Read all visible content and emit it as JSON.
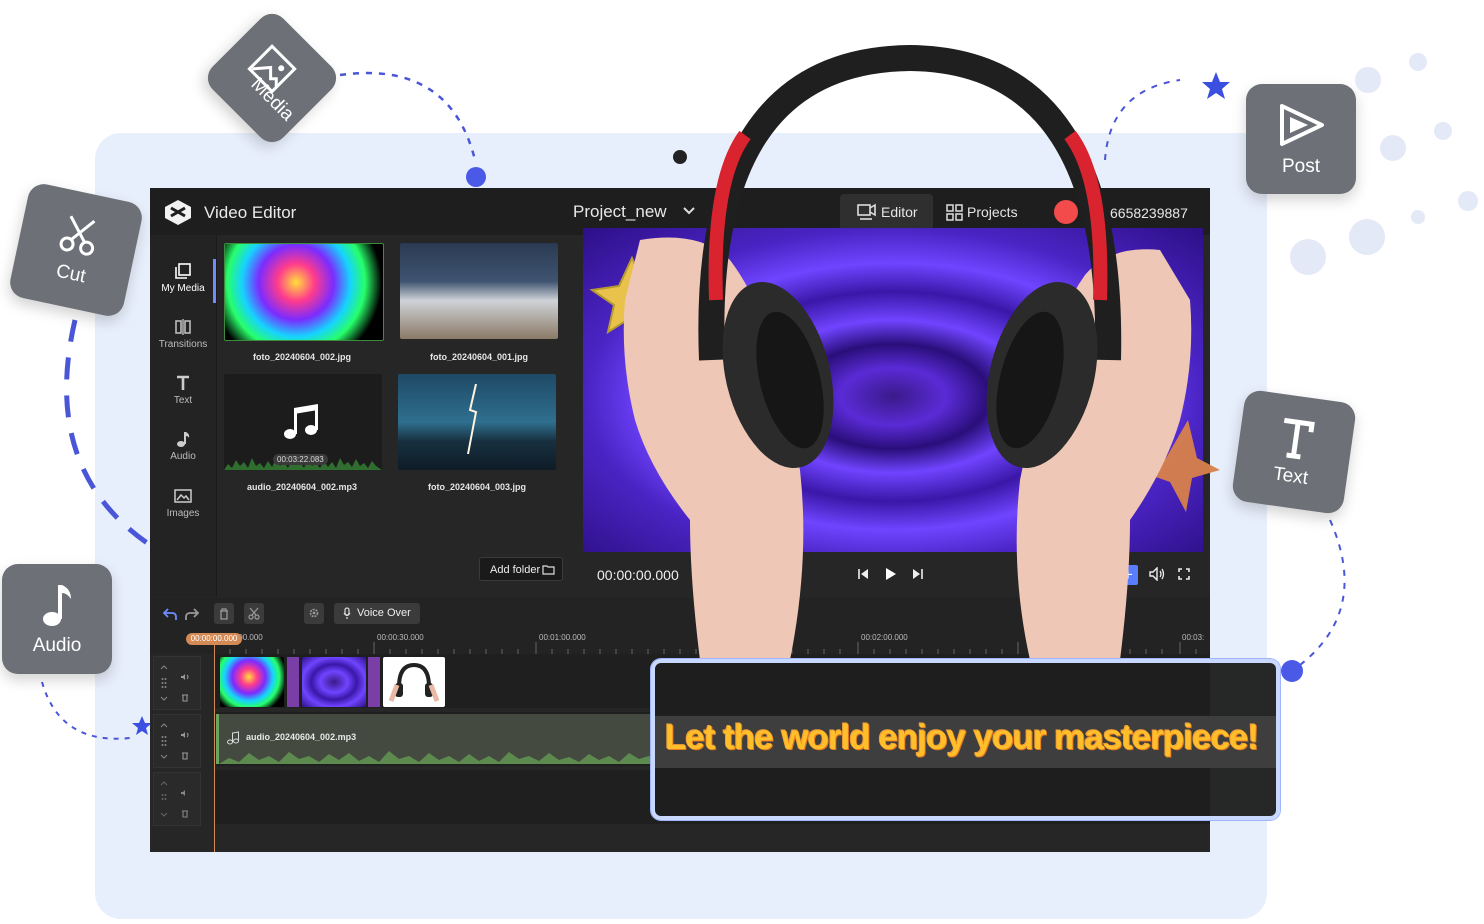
{
  "app": {
    "title": "Video Editor",
    "project_name": "Project_new",
    "tabs": {
      "editor": "Editor",
      "projects": "Projects"
    },
    "user_id": "6658239887"
  },
  "sidebar": {
    "items": [
      {
        "label": "My Media",
        "icon": "my-media-icon",
        "active": true
      },
      {
        "label": "Transitions",
        "icon": "transitions-icon"
      },
      {
        "label": "Text",
        "icon": "text-icon"
      },
      {
        "label": "Audio",
        "icon": "audio-icon"
      },
      {
        "label": "Images",
        "icon": "images-icon"
      }
    ]
  },
  "media": {
    "items": [
      {
        "name": "foto_20240604_002.jpg",
        "kind": "image"
      },
      {
        "name": "foto_20240604_001.jpg",
        "kind": "image"
      },
      {
        "name": "audio_20240604_002.mp3",
        "kind": "audio",
        "duration": "00:03:22.083"
      },
      {
        "name": "foto_20240604_003.jpg",
        "kind": "image"
      }
    ],
    "add_folder_label": "Add folder"
  },
  "player": {
    "timecode": "00:00:00.000"
  },
  "timeline": {
    "voice_over_label": "Voice Over",
    "playhead": "00:00:00.000",
    "ticks": [
      "00:00:00.000",
      "00:00:30.000",
      "00:01:00.000",
      "00:02:00.000",
      "00:03:"
    ],
    "audio_clip_name": "audio_20240604_002.mp3"
  },
  "features": {
    "media": "Media",
    "cut": "Cut",
    "audio": "Audio",
    "post": "Post",
    "text": "Text"
  },
  "caption": "Let the world enjoy your masterpiece!",
  "colors": {
    "accent": "#5a7cff",
    "background_card": "#e8effc",
    "tile": "#6d7177",
    "caption_text": "#ffbf2a"
  }
}
